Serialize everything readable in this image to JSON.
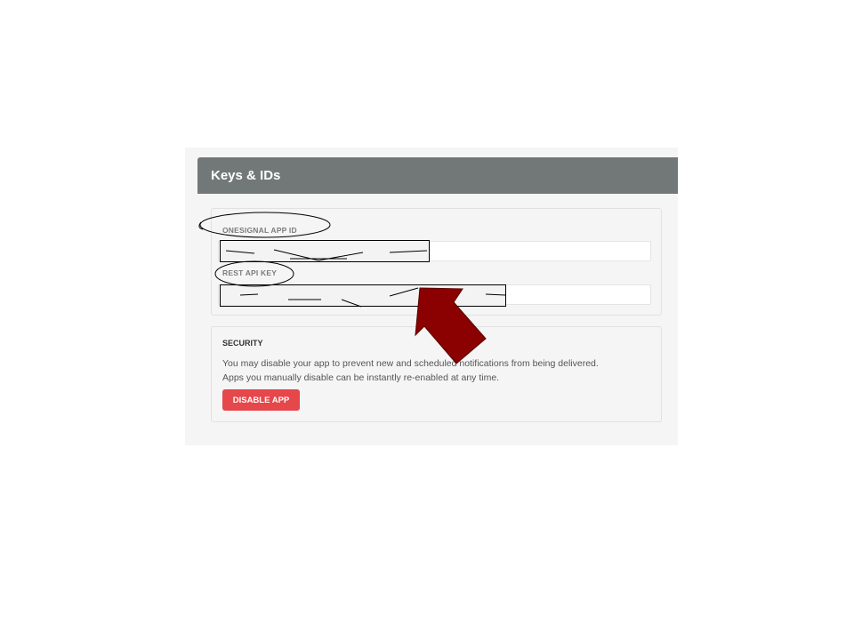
{
  "panel": {
    "title": "Keys & IDs"
  },
  "keys": {
    "app_id_label": "ONESIGNAL APP ID",
    "rest_api_key_label": "REST API KEY"
  },
  "security": {
    "title": "SECURITY",
    "description_line1": "You may disable your app to prevent new and scheduled notifications from being delivered.",
    "description_line2": "Apps you manually disable can be instantly re-enabled at any time.",
    "disable_button_label": "DISABLE APP"
  },
  "colors": {
    "header_bg": "#727878",
    "disable_button": "#e5474a",
    "arrow": "#8b0000"
  }
}
